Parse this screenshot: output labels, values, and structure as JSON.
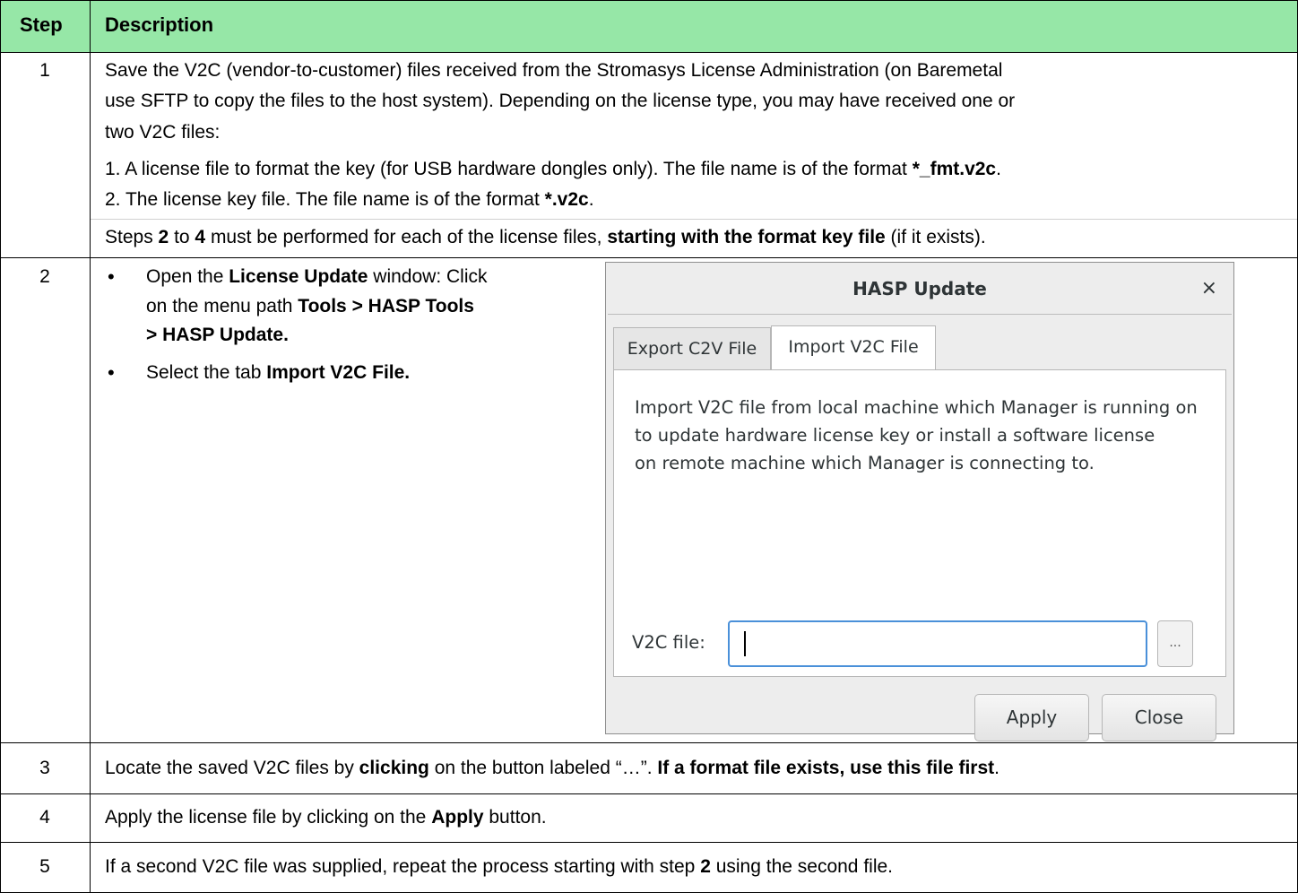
{
  "header": {
    "step": "Step",
    "description": "Description"
  },
  "colors": {
    "header_bg": "#96e7a7",
    "input_focus": "#4a90d9"
  },
  "rows": {
    "r1": {
      "num": "1",
      "l1": "Save the V2C (vendor-to-customer) files received from the Stromasys License Administration (on Baremetal",
      "l2": "use SFTP to copy the files to the host system). Depending on the license type, you may have received one or",
      "l3": "two V2C files:",
      "item1_a": "1. A license file to format the key (for USB hardware dongles only). The file name is of the format ",
      "item1_b": "*_fmt.v2c",
      "item1_c": ".",
      "item2_a": "2. The license key file. The file name is of the format ",
      "item2_b": "*.v2c",
      "item2_c": ".",
      "steps_a": "Steps ",
      "steps_b": "2",
      "steps_c": " to ",
      "steps_d": "4",
      "steps_e": " must be performed for each of the license files, ",
      "steps_f": "starting with the format key file",
      "steps_g": " (if it exists)."
    },
    "r2": {
      "num": "2",
      "b1_a": "Open the ",
      "b1_b": "License Update",
      "b1_c": " window: Click",
      "b1_l2a": "on the menu path ",
      "b1_l2b": "Tools > HASP Tools",
      "b1_l3": "> HASP Update.",
      "b2_a": "Select the tab ",
      "b2_b": "Import V2C File."
    },
    "r3": {
      "num": "3",
      "a": "Locate the saved V2C files by ",
      "b": "clicking",
      "c": " on the button labeled “…”. ",
      "d": "If a format file exists, use this file first",
      "e": "."
    },
    "r4": {
      "num": "4",
      "a": "Apply the license file by clicking on the ",
      "b": "Apply",
      "c": " button."
    },
    "r5": {
      "num": "5",
      "a": "If a second V2C file was supplied, repeat the process starting with step ",
      "b": "2",
      "c": " using the second file."
    }
  },
  "dialog": {
    "title": "HASP Update",
    "close_glyph": "×",
    "tabs": [
      "Export C2V File",
      "Import V2C File"
    ],
    "active_tab": "Import V2C File",
    "description": [
      "Import V2C file from local machine which Manager is running on",
      "to update hardware license key or install a software license",
      "on remote machine which Manager is connecting to."
    ],
    "v2c_label": "V2C file:",
    "v2c_value": "",
    "browse_label": "...",
    "apply_label": "Apply",
    "close_label": "Close",
    "icons": {
      "close": "close-icon"
    }
  }
}
